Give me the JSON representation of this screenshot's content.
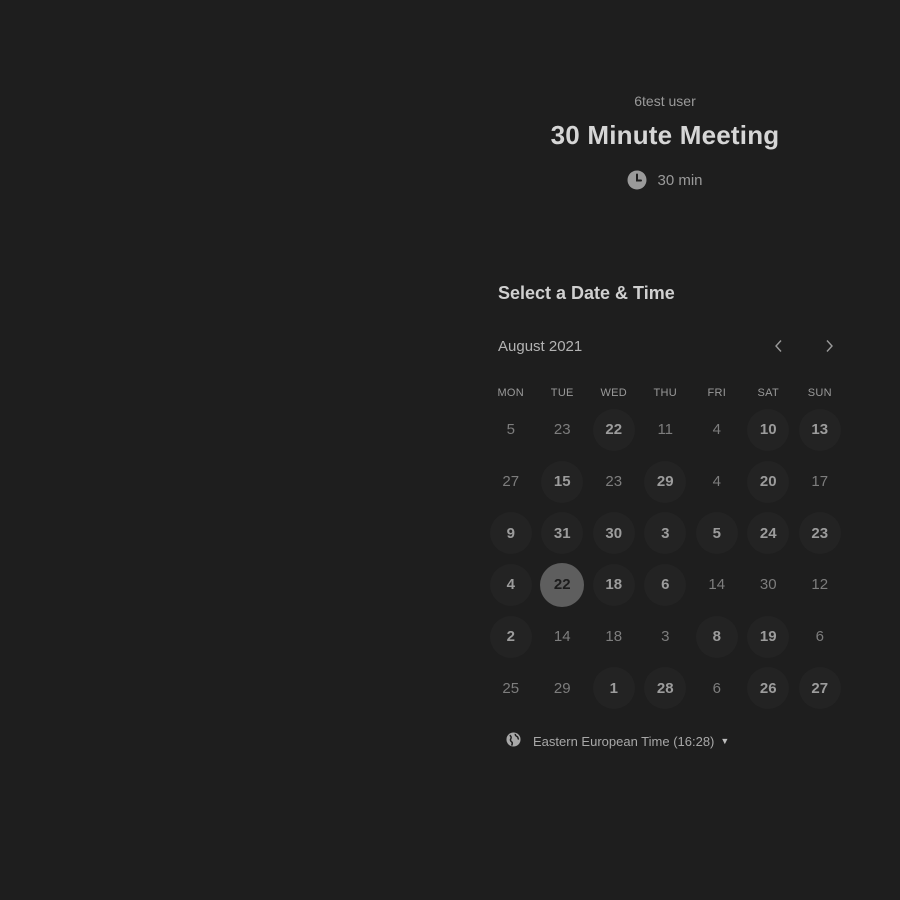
{
  "event": {
    "owner": "6test user",
    "title": "30 Minute Meeting",
    "duration": "30 min",
    "duration_icon": "clock-icon"
  },
  "picker": {
    "heading": "Select a Date & Time",
    "month_label": "August 2021",
    "prev_icon": "chevron-left-icon",
    "next_icon": "chevron-right-icon",
    "weekdays": [
      "MON",
      "TUE",
      "WED",
      "THU",
      "FRI",
      "SAT",
      "SUN"
    ],
    "days": [
      {
        "label": "5",
        "available": false
      },
      {
        "label": "23",
        "available": false
      },
      {
        "label": "22",
        "available": true
      },
      {
        "label": "11",
        "available": false
      },
      {
        "label": "4",
        "available": false
      },
      {
        "label": "10",
        "available": true
      },
      {
        "label": "13",
        "available": true
      },
      {
        "label": "27",
        "available": false
      },
      {
        "label": "15",
        "available": true
      },
      {
        "label": "23",
        "available": false
      },
      {
        "label": "29",
        "available": true
      },
      {
        "label": "4",
        "available": false
      },
      {
        "label": "20",
        "available": true
      },
      {
        "label": "17",
        "available": false
      },
      {
        "label": "9",
        "available": true
      },
      {
        "label": "31",
        "available": true
      },
      {
        "label": "30",
        "available": true
      },
      {
        "label": "3",
        "available": true
      },
      {
        "label": "5",
        "available": true
      },
      {
        "label": "24",
        "available": true
      },
      {
        "label": "23",
        "available": true
      },
      {
        "label": "4",
        "available": true
      },
      {
        "label": "22",
        "available": true,
        "selected": true
      },
      {
        "label": "18",
        "available": true
      },
      {
        "label": "6",
        "available": true
      },
      {
        "label": "14",
        "available": false
      },
      {
        "label": "30",
        "available": false
      },
      {
        "label": "12",
        "available": false
      },
      {
        "label": "2",
        "available": true
      },
      {
        "label": "14",
        "available": false
      },
      {
        "label": "18",
        "available": false
      },
      {
        "label": "3",
        "available": false
      },
      {
        "label": "8",
        "available": true
      },
      {
        "label": "19",
        "available": true
      },
      {
        "label": "6",
        "available": false
      },
      {
        "label": "25",
        "available": false
      },
      {
        "label": "29",
        "available": false
      },
      {
        "label": "1",
        "available": true
      },
      {
        "label": "28",
        "available": true
      },
      {
        "label": "6",
        "available": false
      },
      {
        "label": "26",
        "available": true
      },
      {
        "label": "27",
        "available": true
      }
    ]
  },
  "timezone": {
    "label": "Eastern European Time (16:28)",
    "icon": "globe-icon",
    "caret_icon": "caret-down-icon"
  },
  "colors": {
    "background": "#1e1e1e",
    "selected_day": "#5e5e5e",
    "available_day": "#232323"
  }
}
